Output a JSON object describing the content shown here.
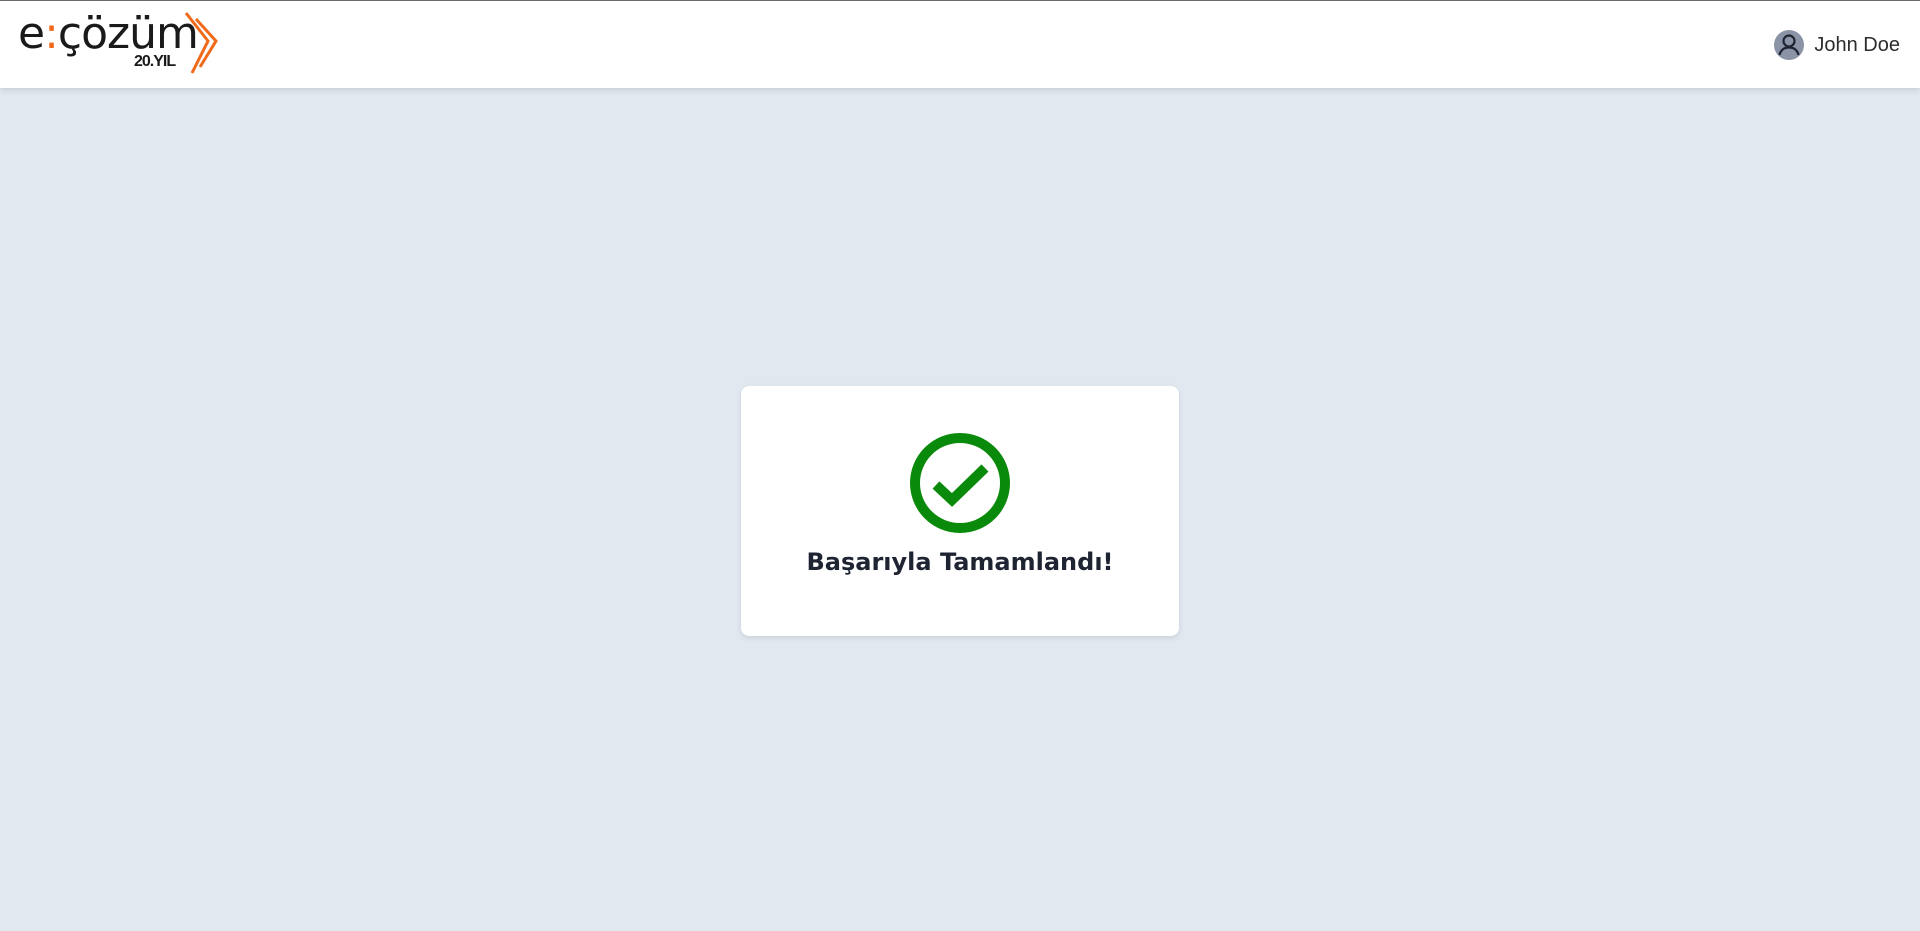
{
  "header": {
    "logo": {
      "word_e": "e",
      "word_colon": ":",
      "word_rest": "çözüm",
      "subtitle": "20.YIL",
      "accent_color": "#f06a1a"
    },
    "user": {
      "name": "John Doe",
      "icon": "user-avatar-icon"
    }
  },
  "main": {
    "status_icon": "check-circle-icon",
    "status_color": "#0a8a0a",
    "message": "Başarıyla Tamamlandı!"
  }
}
